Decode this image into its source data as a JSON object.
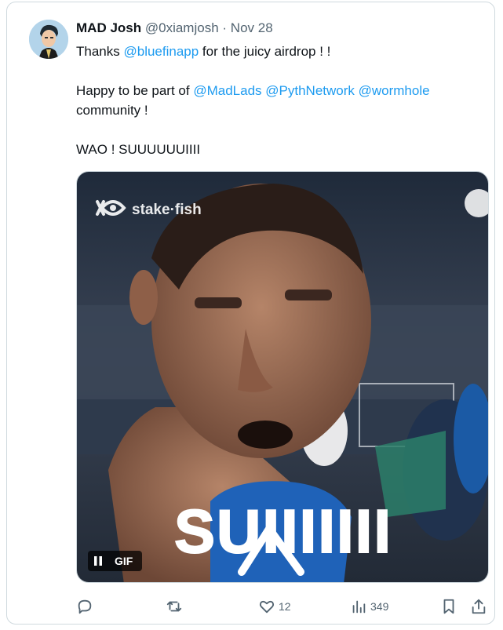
{
  "tweet": {
    "author_name": "MAD Josh",
    "handle": "@0xiamjosh",
    "separator": "·",
    "date": "Nov 28",
    "text": {
      "line1_prefix": "Thanks ",
      "line1_mention": "@bluefinapp",
      "line1_suffix": " for the juicy airdrop ! !",
      "line2_prefix": "Happy to be part of ",
      "line2_mentions": [
        "@MadLads",
        "@PythNetwork",
        "@wormhole"
      ],
      "line2_suffix": "community !",
      "line3": "WAO !  SUUUUUUIIII"
    },
    "media": {
      "watermark": "stake·fish",
      "caption_overlay": "SUIIIIIII",
      "gif_label": "GIF"
    },
    "actions": {
      "reply_count": "",
      "retweet_count": "",
      "like_count": "12",
      "views_count": "349"
    }
  },
  "colors": {
    "link": "#1d9bf0",
    "muted": "#536471",
    "border": "#cfd9de"
  }
}
